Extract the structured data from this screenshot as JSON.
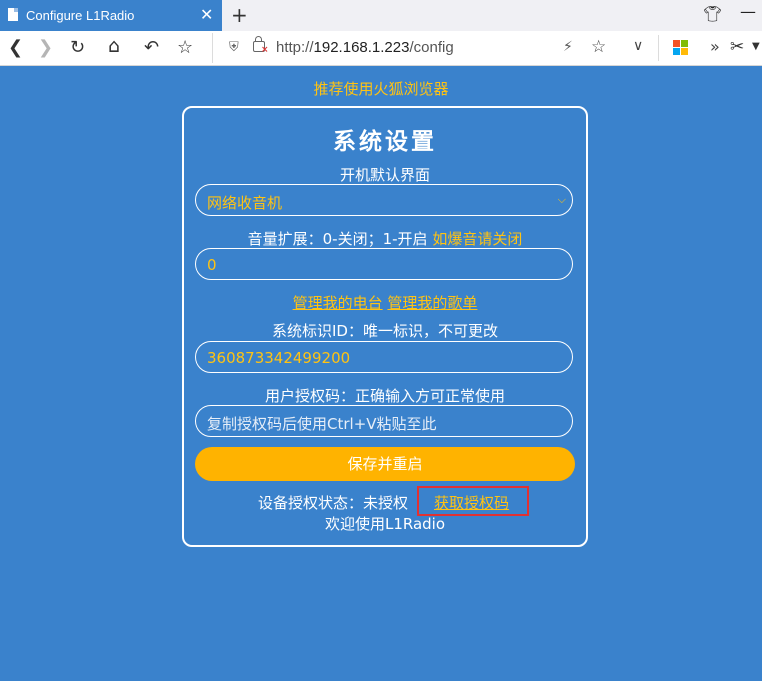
{
  "browser": {
    "tab_title": "Configure L1Radio",
    "tab_close": "✕",
    "new_tab": "+",
    "url_prefix": "http://",
    "url_host": "192.168.1.223",
    "url_path": "/config"
  },
  "page": {
    "recommend": "推荐使用火狐浏览器",
    "title": "系统设置",
    "startup_label": "开机默认界面",
    "startup_value": "网络收音机",
    "volume_label_main": "音量扩展：0-关闭；1-开启 ",
    "volume_label_link": "如爆音请关闭",
    "volume_value": "0",
    "link_manage_stations": "管理我的电台",
    "link_manage_playlist": "管理我的歌单",
    "sysid_label": "系统标识ID：唯一标识，不可更改",
    "sysid_value": "360873342499200",
    "authcode_label": "用户授权码：正确输入方可正常使用",
    "authcode_placeholder": "复制授权码后使用Ctrl+V粘贴至此",
    "save_button": "保存并重启",
    "device_status": "设备授权状态：未授权",
    "get_auth_link": "获取授权码",
    "welcome": "欢迎使用L1Radio"
  },
  "colors": {
    "page_bg": "#3a82cc",
    "accent_yellow": "#ffc312",
    "save_button_bg": "#ffb300",
    "highlight_red": "#e23131"
  },
  "icons": [
    "page-icon",
    "close-icon",
    "plus-icon",
    "shirt-icon",
    "minimize-icon",
    "back-arrow-icon",
    "forward-arrow-icon",
    "reload-icon",
    "home-icon",
    "undo-icon",
    "star-icon",
    "shield-icon",
    "insecure-lock-icon",
    "bolt-icon",
    "bookmark-star-icon",
    "chevron-down-icon",
    "ms-apps-icon",
    "overflow-icon",
    "scissors-icon"
  ]
}
